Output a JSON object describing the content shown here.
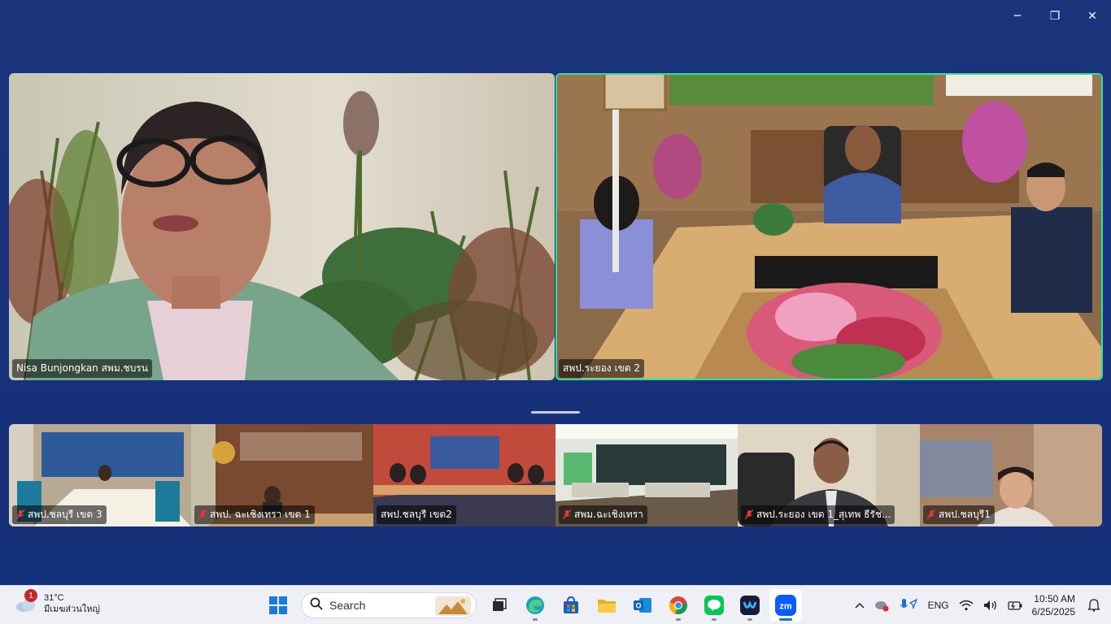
{
  "window": {
    "controls": {
      "minimize": "─",
      "restore": "❐",
      "close": "✕"
    }
  },
  "speakers": [
    {
      "name": "Nisa Bunjongkan สพม.ชบรน",
      "muted": false
    },
    {
      "name": "สพป.ระยอง เขต 2",
      "muted": false
    }
  ],
  "gallery": [
    {
      "name": "สพป.ชลบุรี เขต 3",
      "muted": true
    },
    {
      "name": "สพป. ฉะเชิงเทรา เขต 1",
      "muted": true
    },
    {
      "name": "สพป.ชลบุรี เขต2",
      "muted": false
    },
    {
      "name": "สพม.ฉะเชิงเทรา",
      "muted": true
    },
    {
      "name": "สพป.ระยอง เขต 1_สุเทพ ธีรัช...",
      "muted": true
    },
    {
      "name": "สพป.ชลบุรี1",
      "muted": true
    }
  ],
  "taskbar": {
    "weather": {
      "temp": "31°C",
      "desc": "มีเมฆส่วนใหญ่",
      "badge": "1"
    },
    "search_placeholder": "Search",
    "apps": [
      {
        "icon": "windows-start-icon"
      },
      {
        "icon": "task-view-icon"
      },
      {
        "icon": "edge-icon"
      },
      {
        "icon": "store-icon"
      },
      {
        "icon": "file-explorer-icon"
      },
      {
        "icon": "outlook-icon"
      },
      {
        "icon": "chrome-icon"
      },
      {
        "icon": "line-icon"
      },
      {
        "icon": "webex-icon"
      },
      {
        "icon": "zoom-icon",
        "active": true
      }
    ],
    "tray": {
      "language": "ENG"
    },
    "clock": {
      "time": "10:50 AM",
      "date": "6/25/2025"
    }
  },
  "colors": {
    "background": "#15307a",
    "active_speaker_border": "#2ee09a",
    "taskbar": "#eef0f5"
  }
}
